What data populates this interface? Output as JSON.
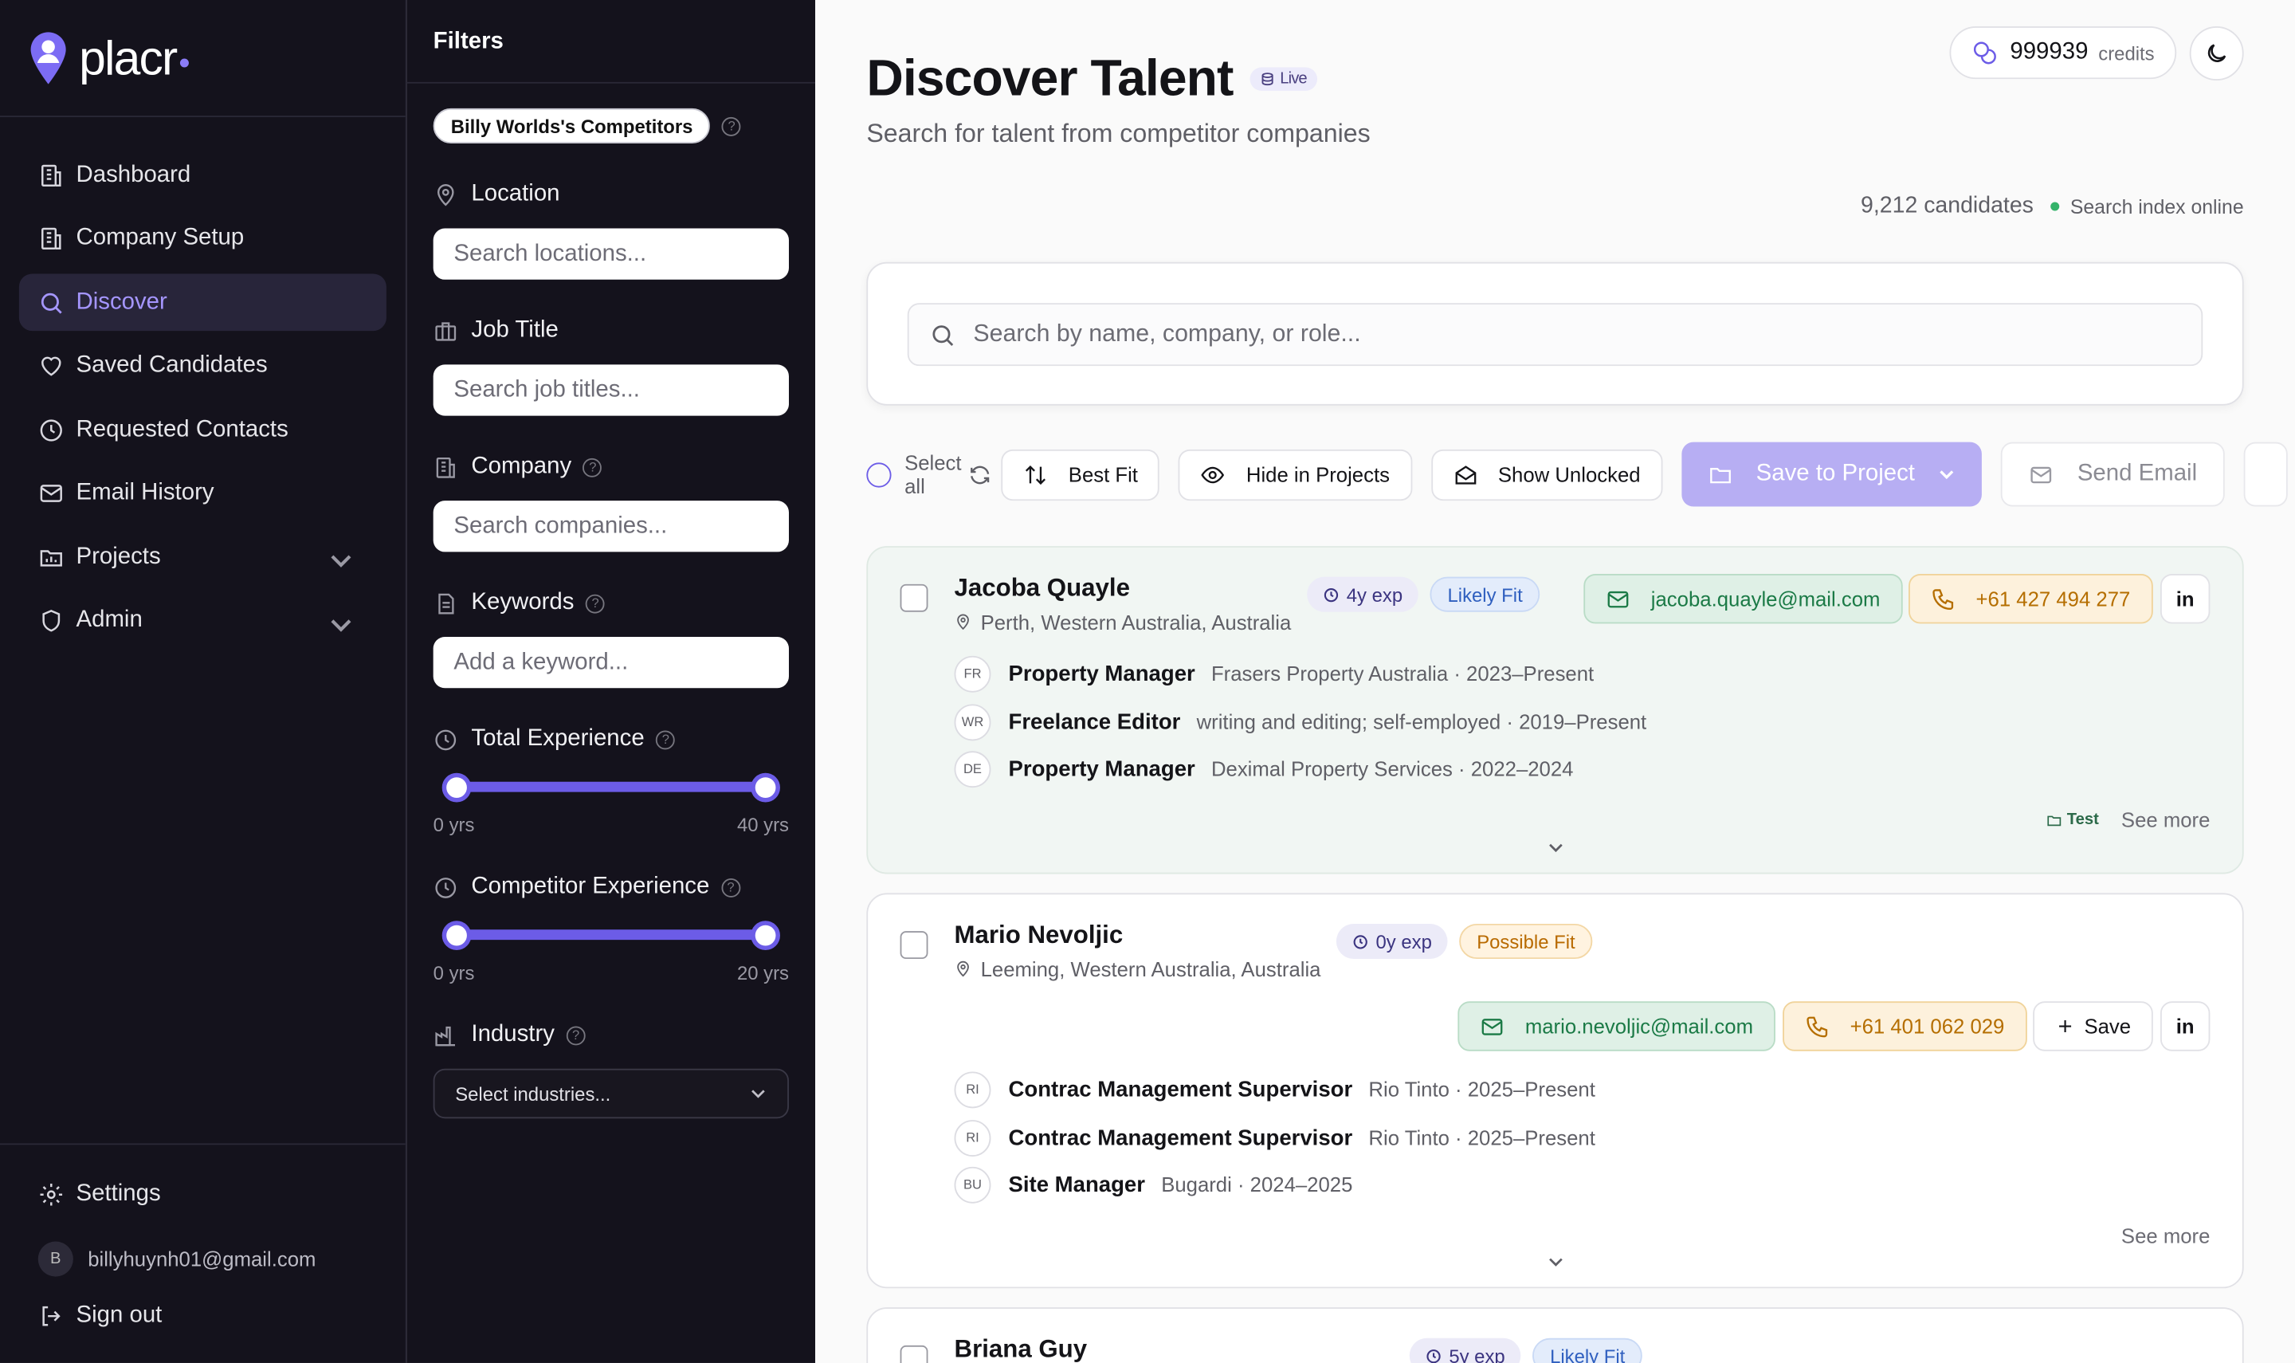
{
  "app": {
    "name": "placr"
  },
  "nav": {
    "items": [
      {
        "id": "dashboard",
        "label": "Dashboard",
        "active": false,
        "expandable": false
      },
      {
        "id": "company-setup",
        "label": "Company Setup",
        "active": false,
        "expandable": false
      },
      {
        "id": "discover",
        "label": "Discover",
        "active": true,
        "expandable": false
      },
      {
        "id": "saved-candidates",
        "label": "Saved Candidates",
        "active": false,
        "expandable": false
      },
      {
        "id": "requested-contacts",
        "label": "Requested Contacts",
        "active": false,
        "expandable": false
      },
      {
        "id": "email-history",
        "label": "Email History",
        "active": false,
        "expandable": false
      },
      {
        "id": "projects",
        "label": "Projects",
        "active": false,
        "expandable": true
      },
      {
        "id": "admin",
        "label": "Admin",
        "active": false,
        "expandable": true
      }
    ],
    "settings": "Settings",
    "user_email": "billyhuynh01@gmail.com",
    "user_initial": "B",
    "sign_out": "Sign out"
  },
  "filters": {
    "title": "Filters",
    "competitor_chip": "Billy Worlds's Competitors",
    "location": {
      "label": "Location",
      "placeholder": "Search locations..."
    },
    "job_title": {
      "label": "Job Title",
      "placeholder": "Search job titles..."
    },
    "company": {
      "label": "Company",
      "placeholder": "Search companies..."
    },
    "keywords": {
      "label": "Keywords",
      "placeholder": "Add a keyword..."
    },
    "total_experience": {
      "label": "Total Experience",
      "min_label": "0 yrs",
      "max_label": "40 yrs",
      "low_fraction": 0,
      "high_fraction": 1
    },
    "competitor_experience": {
      "label": "Competitor Experience",
      "min_label": "0 yrs",
      "max_label": "20 yrs",
      "low_fraction": 0,
      "high_fraction": 1
    },
    "industry": {
      "label": "Industry",
      "placeholder": "Select industries..."
    }
  },
  "header": {
    "title": "Discover Talent",
    "badge": "Live",
    "subtitle": "Search for talent from competitor companies",
    "credits_value": "999939",
    "credits_label": "credits",
    "candidates_count": "9,212 candidates",
    "index_status": "Search index online"
  },
  "search": {
    "placeholder": "Search by name, company, or role..."
  },
  "toolbar": {
    "select_all": "Select all",
    "best_fit": "Best Fit",
    "hide_in_projects": "Hide in Projects",
    "show_unlocked": "Show Unlocked",
    "save_to_project": "Save to Project",
    "send_email": "Send Email"
  },
  "candidates": [
    {
      "name": "Jacoba Quayle",
      "location": "Perth, Western Australia, Australia",
      "exp": "4y exp",
      "fit": "Likely Fit",
      "email": "jacoba.quayle@mail.com",
      "phone": "+61 427 494 277",
      "jobs": [
        {
          "initials": "FR",
          "title": "Property Manager",
          "detail": "Frasers Property Australia · 2023–Present"
        },
        {
          "initials": "WR",
          "title": "Freelance Editor",
          "detail": "writing and editing; self-employed · 2019–Present"
        },
        {
          "initials": "DE",
          "title": "Property Manager",
          "detail": "Deximal Property Services · 2022–2024"
        }
      ],
      "tag": "Test",
      "see_more": "See more"
    },
    {
      "name": "Mario Nevoljic",
      "location": "Leeming, Western Australia, Australia",
      "exp": "0y exp",
      "fit": "Possible Fit",
      "email": "mario.nevoljic@mail.com",
      "phone": "+61 401 062 029",
      "save": "Save",
      "jobs": [
        {
          "initials": "RI",
          "title": "Contrac Management Supervisor",
          "detail": "Rio Tinto · 2025–Present"
        },
        {
          "initials": "RI",
          "title": "Contrac Management Supervisor",
          "detail": "Rio Tinto · 2025–Present"
        },
        {
          "initials": "BU",
          "title": "Site Manager",
          "detail": "Bugardi · 2024–2025"
        }
      ],
      "see_more": "See more"
    },
    {
      "name": "Briana Guy",
      "exp": "5y exp",
      "fit": "Likely Fit"
    }
  ],
  "colors": {
    "accent": "#6c5ce7",
    "sidebar_bg": "#14121c",
    "email_green": "#1b7a46",
    "phone_orange": "#b56e00"
  }
}
